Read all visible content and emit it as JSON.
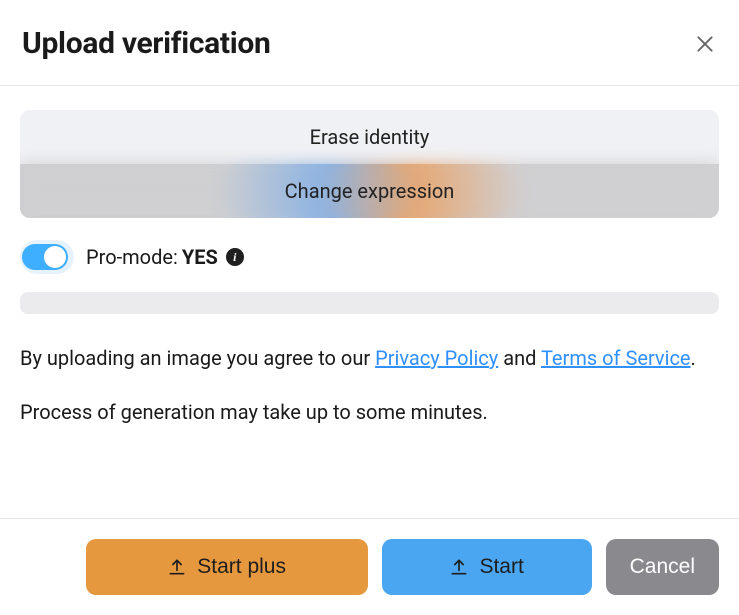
{
  "header": {
    "title": "Upload verification"
  },
  "tabs": {
    "erase": "Erase identity",
    "change": "Change expression"
  },
  "proMode": {
    "labelPrefix": "Pro-mode: ",
    "value": "YES"
  },
  "agreement": {
    "prefix": "By uploading an image you agree to our ",
    "privacy": "Privacy Policy",
    "and": " and ",
    "terms": "Terms of Service",
    "suffix": "."
  },
  "processNote": "Process of generation may take up to some minutes.",
  "buttons": {
    "startPlus": "Start plus",
    "start": "Start",
    "cancel": "Cancel"
  }
}
